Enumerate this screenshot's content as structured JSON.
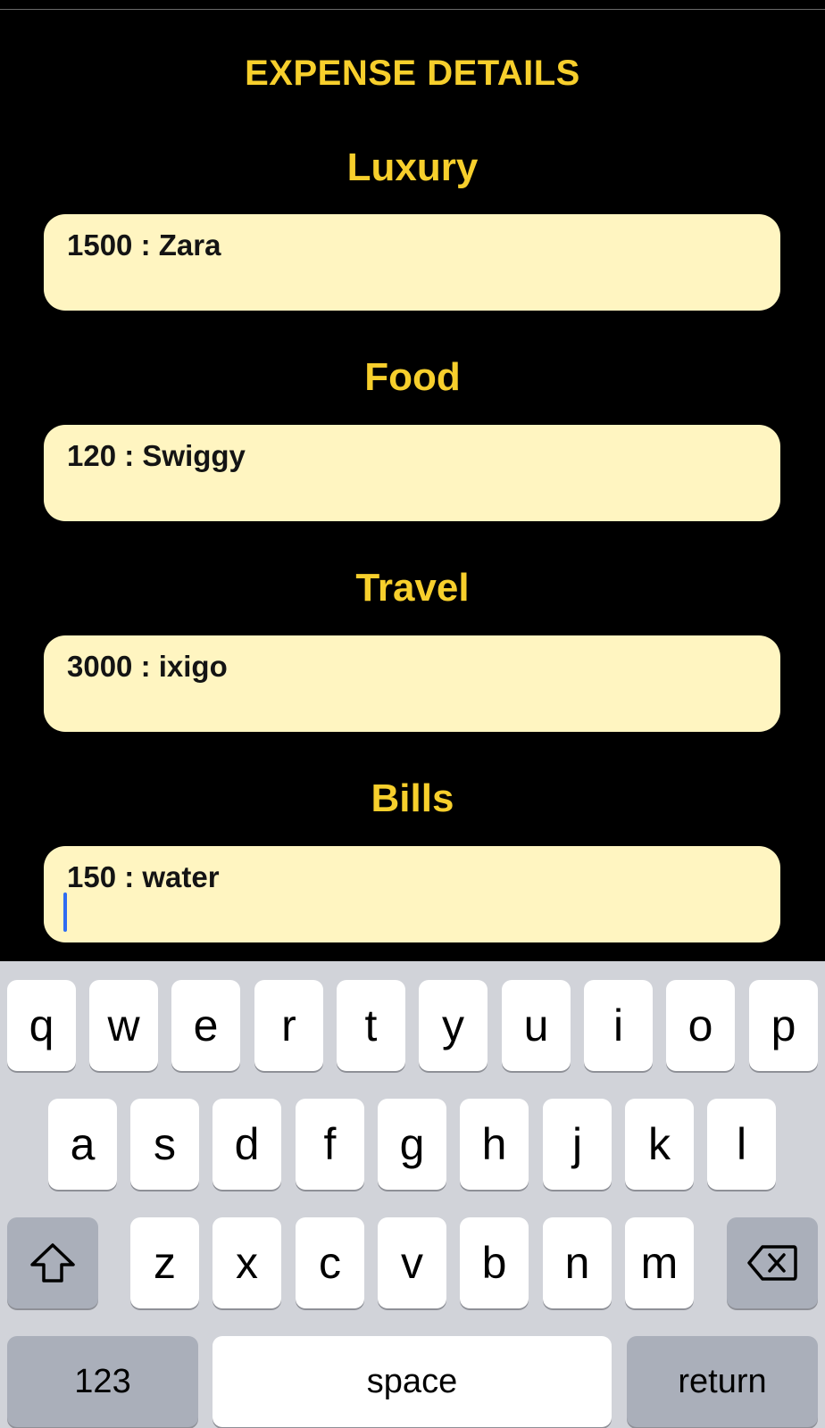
{
  "header": {
    "title": "EXPENSE DETAILS"
  },
  "categories": [
    {
      "label": "Luxury",
      "entry": "1500 : Zara"
    },
    {
      "label": "Food",
      "entry": "120 : Swiggy"
    },
    {
      "label": "Travel",
      "entry": "3000 : ixigo"
    },
    {
      "label": "Bills",
      "entry": "150 : water"
    }
  ],
  "keyboard": {
    "row1": [
      "q",
      "w",
      "e",
      "r",
      "t",
      "y",
      "u",
      "i",
      "o",
      "p"
    ],
    "row2": [
      "a",
      "s",
      "d",
      "f",
      "g",
      "h",
      "j",
      "k",
      "l"
    ],
    "row3": [
      "z",
      "x",
      "c",
      "v",
      "b",
      "n",
      "m"
    ],
    "numbers_label": "123",
    "space_label": "space",
    "return_label": "return",
    "shift_icon": "shift-arrow-icon",
    "delete_icon": "backspace-icon"
  },
  "colors": {
    "background": "#000000",
    "accent": "#f7cf2c",
    "entry_background": "#fff5c1",
    "caret": "#2f6cf2",
    "keyboard_background": "#d1d3d9"
  }
}
